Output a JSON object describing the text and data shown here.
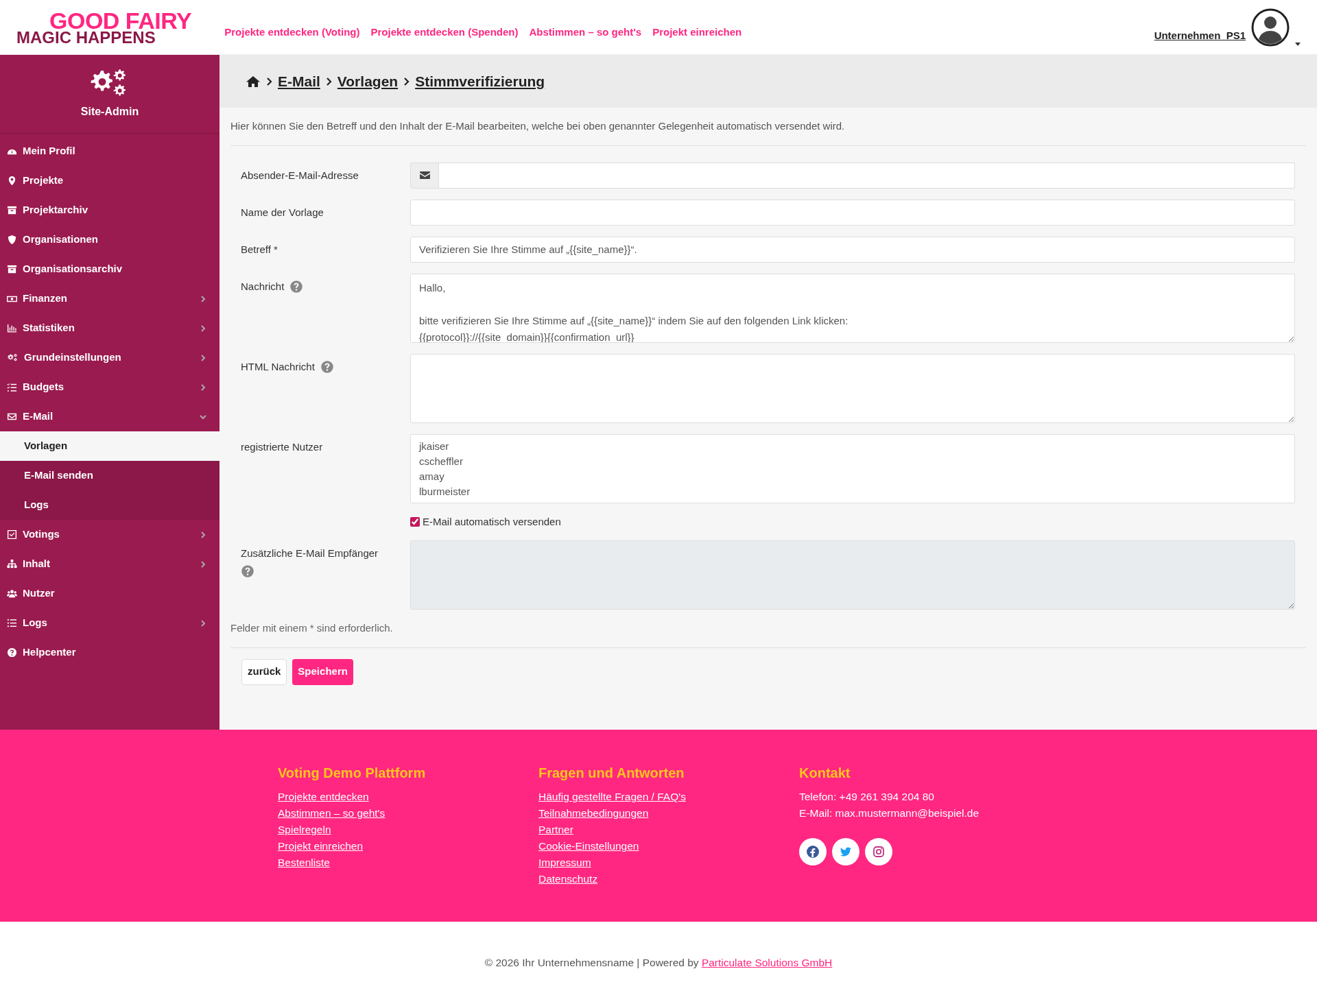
{
  "header": {
    "logo": {
      "top": "GOOD FAIRY",
      "bottom": "MAGIC HAPPENS"
    },
    "nav": [
      "Projekte entdecken (Voting)",
      "Projekte entdecken (Spenden)",
      "Abstimmen – so geht's",
      "Projekt einreichen"
    ],
    "user": "Unternehmen_PS1"
  },
  "sidebar": {
    "title": "Site-Admin",
    "items": [
      {
        "label": "Mein Profil",
        "kind": "link"
      },
      {
        "label": "Projekte",
        "kind": "link"
      },
      {
        "label": "Projektarchiv",
        "kind": "link"
      },
      {
        "label": "Organisationen",
        "kind": "link"
      },
      {
        "label": "Organisationsarchiv",
        "kind": "link"
      },
      {
        "label": "Finanzen",
        "kind": "group",
        "expanded": false
      },
      {
        "label": "Statistiken",
        "kind": "group",
        "expanded": false
      },
      {
        "label": "Grundeinstellungen",
        "kind": "group",
        "expanded": false
      },
      {
        "label": "Budgets",
        "kind": "group",
        "expanded": false
      },
      {
        "label": "E-Mail",
        "kind": "group",
        "expanded": true,
        "children": [
          {
            "label": "Vorlagen",
            "selected": true
          },
          {
            "label": "E-Mail senden",
            "selected": false
          },
          {
            "label": "Logs",
            "selected": false
          }
        ]
      },
      {
        "label": "Votings",
        "kind": "group",
        "expanded": false
      },
      {
        "label": "Inhalt",
        "kind": "group",
        "expanded": false
      },
      {
        "label": "Nutzer",
        "kind": "link"
      },
      {
        "label": "Logs",
        "kind": "group",
        "expanded": false
      },
      {
        "label": "Helpcenter",
        "kind": "link"
      }
    ]
  },
  "breadcrumb": [
    "E-Mail",
    "Vorlagen",
    "Stimmverifizierung"
  ],
  "intro": "Hier können Sie den Betreff und den Inhalt der E-Mail bearbeiten, welche bei oben genannter Gelegenheit automatisch versendet wird.",
  "form": [
    {
      "kind": "email",
      "label": "Absender-E-Mail-Adresse",
      "help": false
    },
    {
      "kind": "text",
      "label": "Name der Vorlage",
      "help": false
    },
    {
      "kind": "text",
      "label": "Betreff *",
      "help": false,
      "value": "Verifizieren Sie Ihre Stimme auf „{{site_name}}“."
    },
    {
      "kind": "textarea",
      "label": "Nachricht",
      "help": true,
      "value": "Hallo,\n\nbitte verifizieren Sie Ihre Stimme auf „{{site_name}}“ indem Sie auf den folgenden Link klicken:\n{{protocol}}://{{site_domain}}{{confirmation_url}}"
    },
    {
      "kind": "textarea",
      "label": "HTML Nachricht",
      "help": true
    },
    {
      "kind": "multiselect",
      "label": "registrierte Nutzer",
      "help": false,
      "options": [
        "jkaiser",
        "cscheffler",
        "amay",
        "lburmeister"
      ]
    },
    {
      "kind": "checkbox",
      "label": "E-Mail automatisch versenden",
      "checked": true
    },
    {
      "kind": "textarea",
      "label": "Zusätzliche E-Mail Empfänger",
      "help": true,
      "help_below": true,
      "disabled": true
    }
  ],
  "required_note": "Felder mit einem * sind erforderlich.",
  "buttons": [
    {
      "label": "zurück",
      "kind": "secondary"
    },
    {
      "label": "Speichern",
      "kind": "primary"
    }
  ],
  "footer": {
    "columns": [
      {
        "title": "Voting Demo Plattform",
        "links": [
          "Projekte entdecken",
          "Abstimmen – so geht's",
          "Spielregeln",
          "Projekt einreichen",
          "Bestenliste"
        ]
      },
      {
        "title": "Fragen und Antworten",
        "links": [
          "Häufig gestellte Fragen / FAQ's",
          "Teilnahmebedingungen",
          "Partner",
          "Cookie-Einstellungen",
          "Impressum",
          "Datenschutz"
        ]
      },
      {
        "title": "Kontakt",
        "lines": [
          "Telefon: +49 261 394 204 80",
          "E-Mail: max.mustermann@beispiel.de"
        ],
        "social": true
      }
    ],
    "copyright": "© 2026 Ihr Unternehmensname | Powered by",
    "powered_link": "Particulate Solutions GmbH"
  }
}
